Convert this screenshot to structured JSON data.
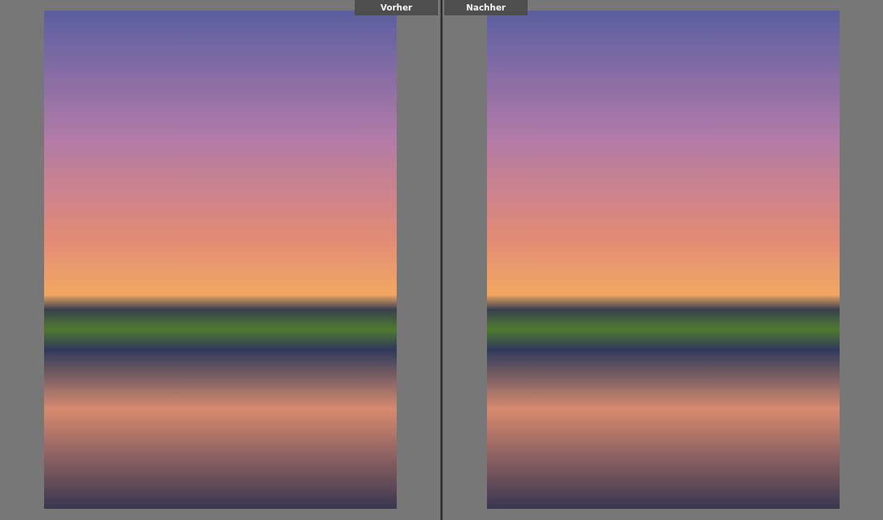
{
  "panes": [
    {
      "label": "Vorher"
    },
    {
      "label": "Nachher"
    }
  ]
}
